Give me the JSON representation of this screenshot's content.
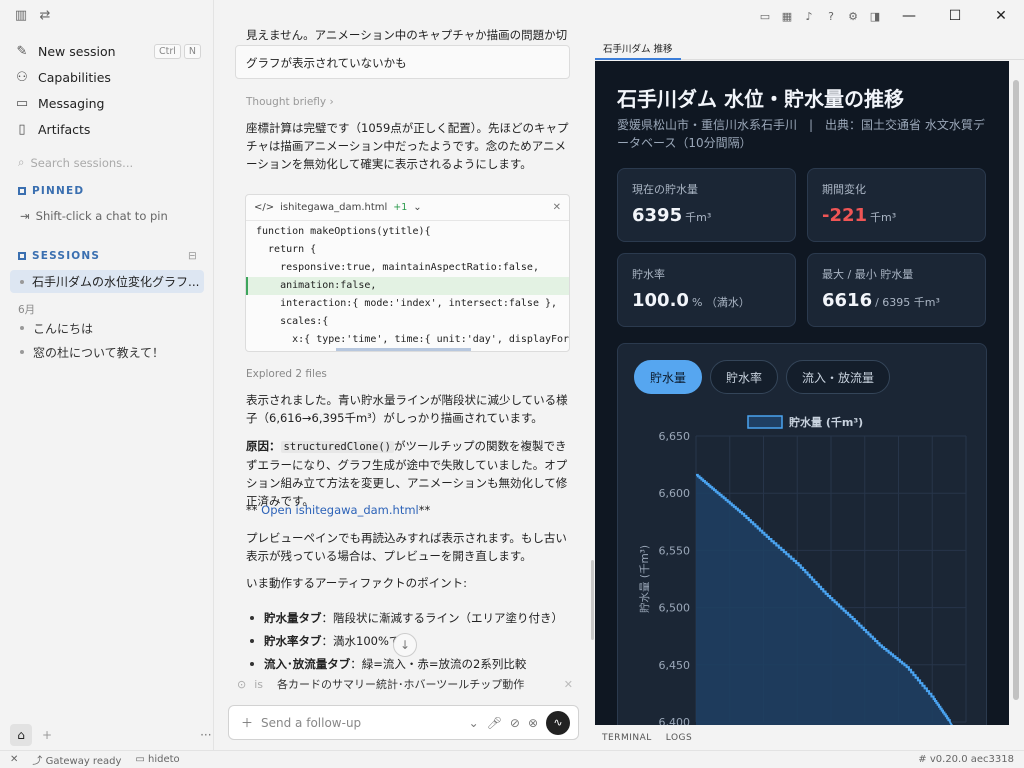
{
  "sidebar": {
    "new_session": "New session",
    "new_session_keys": [
      "Ctrl",
      "N"
    ],
    "capabilities": "Capabilities",
    "messaging": "Messaging",
    "artifacts": "Artifacts",
    "search_placeholder": "Search sessions...",
    "pinned_header": "PINNED",
    "pinned_hint": "Shift-click a chat to pin",
    "sessions_header": "SESSIONS",
    "active_session": "石手川ダムの水位変化グラフ...",
    "month": "6月",
    "sessions": [
      "こんにちは",
      "窓の杜について教えて！"
    ]
  },
  "status_bar": {
    "gateway": "Gateway ready",
    "folder": "hideto",
    "version": "# v0.20.0 aec3318"
  },
  "chat": {
    "top_text": "見えません。アニメーション中のキャプチャか描画の問題か切り分けます。",
    "user_message": "グラフが表示されていないかも",
    "thought": "Thought briefly",
    "para1": "座標計算は完璧です（1059点が正しく配置）。先ほどのキャプチャは描画アニメーション中だったようです。念のためアニメーションを無効化して確実に表示されるようにします。",
    "code_file": "ishitegawa_dam.html",
    "code_added": "+1",
    "code_lines": [
      "function makeOptions(ytitle){",
      "  return {",
      "    responsive:true, maintainAspectRatio:false,",
      "    animation:false,",
      "    interaction:{ mode:'index', intersect:false },",
      "    scales:{",
      "      x:{ type:'time', time:{ unit:'day', displayFor"
    ],
    "explored": "Explored 2 files",
    "para2": "表示されました。青い貯水量ラインが階段状に減少している様子（6,616→6,395千m³）がしっかり描画されています。",
    "cause_label": "原因：",
    "cause_code": "structuredClone()",
    "cause_text": "がツールチップの関数を複製できずエラーになり、グラフ生成が途中で失敗していました。オプション組み立て方法を変更し、アニメーションも無効化して修正済みです。",
    "link_prefix": "** ",
    "link_text": "Open ishitegawa_dam.html",
    "link_suffix": "**",
    "para3": "プレビューペインでも再読込みすれば表示されます。もし古い表示が残っている場合は、プレビューを開き直します。",
    "para4": "いま動作するアーティファクトのポイント:",
    "bullets": [
      {
        "bold": "貯水量タブ",
        "text": "：階段状に漸減するライン（エリア塗り付き）"
      },
      {
        "bold": "貯水率タブ",
        "text": "：満水100%で"
      },
      {
        "bold": "流入･放流量タブ",
        "text": "：緑=流入・赤=放流の2系列比較"
      },
      {
        "bold": "",
        "text": "各カードのサマリー統計･ホバーツールチップ動作"
      }
    ],
    "ghost_text": "is",
    "composer_placeholder": "Send a follow-up"
  },
  "pane": {
    "tab": "石手川ダム 推移",
    "bottom_tabs": [
      "TERMINAL",
      "LOGS"
    ]
  },
  "preview": {
    "title": "石手川ダム 水位・貯水量の推移",
    "subtitle": "愛媛県松山市・重信川水系石手川　|　出典：国土交通省 水文水質データベース（10分間隔）",
    "cards": [
      {
        "label": "現在の貯水量",
        "value": "6395",
        "unit": "千m³",
        "negative": false
      },
      {
        "label": "期間変化",
        "value": "-221",
        "unit": "千m³",
        "negative": true
      },
      {
        "label": "貯水率",
        "value": "100.0",
        "unit": "% （満水）",
        "negative": false
      },
      {
        "label": "最大 / 最小 貯水量",
        "value": "6616",
        "unit": "/ 6395 千m³",
        "negative": false
      }
    ],
    "tabs": [
      "貯水量",
      "貯水率",
      "流入・放流量"
    ],
    "active_tab": 0
  },
  "chart_data": {
    "type": "area",
    "title": "",
    "legend": "貯水量 (千m³)",
    "ylabel": "貯水量 (千m³)",
    "xlabel": "",
    "ylim": [
      6400,
      6650
    ],
    "yticks": [
      "6,650",
      "6,600",
      "6,550",
      "6,500",
      "6,450",
      "6,400"
    ],
    "grid": true,
    "x_fraction": [
      0.0,
      0.08,
      0.17,
      0.27,
      0.38,
      0.48,
      0.58,
      0.68,
      0.78,
      0.88,
      0.94
    ],
    "values": [
      6616,
      6600,
      6582,
      6560,
      6537,
      6512,
      6490,
      6467,
      6448,
      6420,
      6400
    ],
    "colors": {
      "line": "#4aa3f0",
      "fill": "#1f3f63"
    }
  }
}
